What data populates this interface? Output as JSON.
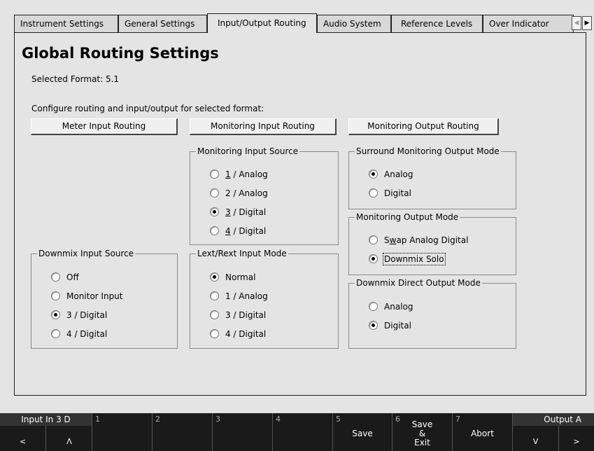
{
  "tabs": [
    {
      "label": "Instrument Settings",
      "active": false
    },
    {
      "label": "General Settings",
      "active": false
    },
    {
      "label": "Input/Output Routing",
      "active": true
    },
    {
      "label": "Audio System",
      "active": false
    },
    {
      "label": "Reference Levels",
      "active": false
    },
    {
      "label": "Over Indicator",
      "active": false
    }
  ],
  "tab_scroll": {
    "left_icon": "scroll-left-icon",
    "right_icon": "scroll-right-icon",
    "left_glyph": "◀",
    "right_glyph": "▶"
  },
  "page": {
    "title": "Global Routing Settings",
    "selected_format": "Selected Format: 5.1",
    "configure_text": "Configure routing and input/output for selected format:"
  },
  "buttons": {
    "meter_input_routing": "Meter Input Routing",
    "monitoring_input_routing": "Monitoring Input Routing",
    "monitoring_output_routing": "Monitoring Output Routing"
  },
  "groups": {
    "monitoring_input_source": {
      "title": "Monitoring Input Source",
      "options": [
        {
          "accel": "1",
          "rest": " / Analog",
          "checked": false
        },
        {
          "accel": "",
          "rest": "2 / Analog",
          "checked": false
        },
        {
          "accel": "3",
          "rest": " / Digital",
          "checked": true
        },
        {
          "accel": "4",
          "rest": " / Digital",
          "checked": false
        }
      ]
    },
    "surround_monitoring_output_mode": {
      "title": "Surround Monitoring Output Mode",
      "options": [
        {
          "label": "Analog",
          "checked": true
        },
        {
          "label": "Digital",
          "checked": false
        }
      ]
    },
    "monitoring_output_mode": {
      "title": "Monitoring Output Mode",
      "options": [
        {
          "pre": "S",
          "accel": "w",
          "rest": "ap Analog Digital",
          "checked": false
        },
        {
          "pre": "",
          "accel": "",
          "rest": "Downmix Solo",
          "checked": true
        }
      ]
    },
    "downmix_input_source": {
      "title": "Downmix Input Source",
      "options": [
        {
          "label": "Off",
          "checked": false
        },
        {
          "label": "Monitor Input",
          "checked": false
        },
        {
          "label": "3 / Digital",
          "checked": true
        },
        {
          "label": "4 / Digital",
          "checked": false
        }
      ]
    },
    "lext_rext_input_mode": {
      "title": "Lext/Rext Input Mode",
      "options": [
        {
          "label": "Normal",
          "checked": true
        },
        {
          "label": "1 / Analog",
          "checked": false
        },
        {
          "label": "3 / Digital",
          "checked": false
        },
        {
          "label": "4 / Digital",
          "checked": false
        }
      ]
    },
    "downmix_direct_output_mode": {
      "title": "Downmix Direct Output Mode",
      "options": [
        {
          "label": "Analog",
          "checked": false
        },
        {
          "label": "Digital",
          "checked": true
        }
      ]
    }
  },
  "softkeys": {
    "input_label": "Input In 3 D",
    "input_left_arrow": "<",
    "input_up_arrow": "Λ",
    "keys": [
      {
        "num": "1",
        "label": ""
      },
      {
        "num": "2",
        "label": ""
      },
      {
        "num": "3",
        "label": ""
      },
      {
        "num": "4",
        "label": ""
      },
      {
        "num": "5",
        "label": "Save"
      },
      {
        "num": "6",
        "label_lines": [
          "Save",
          "&",
          "Exit"
        ]
      },
      {
        "num": "7",
        "label": "Abort"
      }
    ],
    "output_label": "Output A",
    "output_down_arrow": "V",
    "output_right_arrow": ">"
  }
}
